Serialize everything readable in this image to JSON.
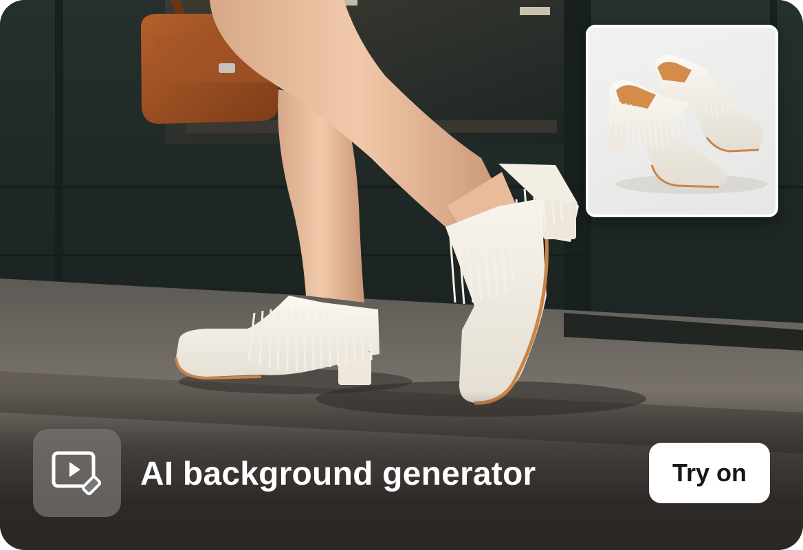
{
  "feature": {
    "icon": "video-edit-icon",
    "title": "AI background generator"
  },
  "cta": {
    "label": "Try on"
  },
  "hero": {
    "subject": "legs-walking-in-white-fringe-mules",
    "accessory": "brown-leather-handbag"
  },
  "thumbnail": {
    "subject": "white-fringe-mules-product-shot"
  },
  "colors": {
    "cta_bg": "#ffffff",
    "cta_text": "#15171a",
    "title_text": "#ffffff",
    "icon_tile": "#787674",
    "storefront": "#1f2a27",
    "pavement": "#6e6861"
  }
}
